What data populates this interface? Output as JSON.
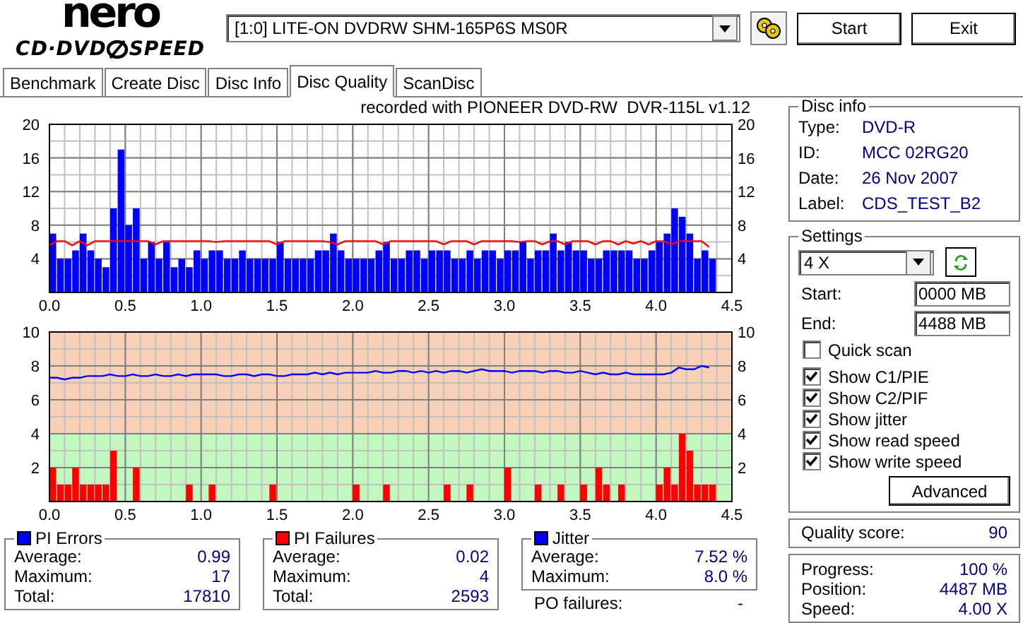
{
  "logo": {
    "brand": "nero",
    "product_left": "CD·DVD",
    "product_right": "SPEED"
  },
  "drive": {
    "value": "[1:0]  LITE-ON DVDRW SHM-165P6S MS0R"
  },
  "buttons": [
    "Start",
    "Exit"
  ],
  "tabs": [
    {
      "label": "Benchmark",
      "selected": false
    },
    {
      "label": "Create Disc",
      "selected": false
    },
    {
      "label": "Disc Info",
      "selected": false
    },
    {
      "label": "Disc Quality",
      "selected": true
    },
    {
      "label": "ScanDisc",
      "selected": false
    }
  ],
  "panels": [
    {
      "title": "recorded with PIONEER DVD-RW  DVR-115L v1.12",
      "charts": [
        {
          "chart_data": {
            "type": "bar",
            "grid": true,
            "xlim": [
              0,
              4.5
            ],
            "ylim": [
              0,
              20
            ],
            "xticks": [
              {
                "value": 0,
                "label": "0.0"
              },
              {
                "value": 0.5,
                "label": "0.5"
              },
              {
                "value": 1,
                "label": "1.0"
              },
              {
                "value": 1.5,
                "label": "1.5"
              },
              {
                "value": 2,
                "label": "2.0"
              },
              {
                "value": 2.5,
                "label": "2.5"
              },
              {
                "value": 3,
                "label": "3.0"
              },
              {
                "value": 3.5,
                "label": "3.5"
              },
              {
                "value": 4,
                "label": "4.0"
              },
              {
                "value": 4.5,
                "label": "4.5"
              }
            ],
            "yticks": [
              {
                "value": 4,
                "label": "4"
              },
              {
                "value": 8,
                "label": "8"
              },
              {
                "value": 12,
                "label": "12"
              },
              {
                "value": 16,
                "label": "16"
              },
              {
                "value": 20,
                "label": "20"
              }
            ],
            "x": [
              0,
              0.05,
              0.1,
              0.15,
              0.2,
              0.25,
              0.3,
              0.35,
              0.4,
              0.45,
              0.5,
              0.55,
              0.6,
              0.65,
              0.7,
              0.75,
              0.8,
              0.85,
              0.9,
              0.95,
              1,
              1.05,
              1.1,
              1.15,
              1.2,
              1.25,
              1.3,
              1.35,
              1.4,
              1.45,
              1.5,
              1.55,
              1.6,
              1.65,
              1.7,
              1.75,
              1.8,
              1.85,
              1.9,
              1.95,
              2,
              2.05,
              2.1,
              2.15,
              2.2,
              2.25,
              2.3,
              2.35,
              2.4,
              2.45,
              2.5,
              2.55,
              2.6,
              2.65,
              2.7,
              2.75,
              2.8,
              2.85,
              2.9,
              2.95,
              3,
              3.05,
              3.1,
              3.15,
              3.2,
              3.25,
              3.3,
              3.35,
              3.4,
              3.45,
              3.5,
              3.55,
              3.6,
              3.65,
              3.7,
              3.75,
              3.8,
              3.85,
              3.9,
              3.95,
              4,
              4.05,
              4.1,
              4.15,
              4.2,
              4.25,
              4.3,
              4.35
            ],
            "series": [
              {
                "color": "#0000ff",
                "values": [
                  7,
                  4,
                  4,
                  5,
                  7,
                  5,
                  4,
                  3,
                  10,
                  17,
                  8,
                  10,
                  4,
                  6,
                  4,
                  6,
                  3,
                  4,
                  3,
                  5,
                  4,
                  5,
                  5,
                  4,
                  4,
                  5,
                  4,
                  4,
                  4,
                  4,
                  6,
                  4,
                  4,
                  4,
                  4,
                  5,
                  5,
                  7,
                  5,
                  4,
                  4,
                  4,
                  4,
                  5,
                  6,
                  4,
                  4,
                  5,
                  5,
                  4,
                  5,
                  5,
                  5,
                  4,
                  4,
                  5,
                  4,
                  5,
                  5,
                  4,
                  5,
                  5,
                  6,
                  4,
                  5,
                  5,
                  7,
                  5,
                  6,
                  5,
                  5,
                  4,
                  4,
                  5,
                  5,
                  5,
                  5,
                  4,
                  4,
                  5,
                  6,
                  7,
                  10,
                  9,
                  7,
                  4,
                  5,
                  4
                ]
              }
            ]
          }
        },
        {
          "chart_data": {
            "type": "line",
            "xlim": [
              0,
              4.5
            ],
            "ylim": [
              0,
              20
            ],
            "yticks": [
              {
                "value": 4,
                "label": "4"
              },
              {
                "value": 8,
                "label": "8"
              },
              {
                "value": 12,
                "label": "12"
              },
              {
                "value": 16,
                "label": "16"
              },
              {
                "value": 20,
                "label": "20"
              }
            ],
            "x": [
              0,
              0.05,
              0.1,
              0.15,
              0.2,
              0.25,
              0.3,
              0.35,
              0.4,
              0.45,
              0.5,
              0.55,
              0.6,
              0.65,
              0.7,
              0.75,
              0.8,
              0.85,
              0.9,
              0.95,
              1,
              1.05,
              1.1,
              1.15,
              1.2,
              1.25,
              1.3,
              1.35,
              1.4,
              1.45,
              1.5,
              1.55,
              1.6,
              1.65,
              1.7,
              1.75,
              1.8,
              1.85,
              1.9,
              1.95,
              2,
              2.05,
              2.1,
              2.15,
              2.2,
              2.25,
              2.3,
              2.35,
              2.4,
              2.45,
              2.5,
              2.55,
              2.6,
              2.65,
              2.7,
              2.75,
              2.8,
              2.85,
              2.9,
              2.95,
              3,
              3.05,
              3.1,
              3.15,
              3.2,
              3.25,
              3.3,
              3.35,
              3.4,
              3.45,
              3.5,
              3.55,
              3.6,
              3.65,
              3.7,
              3.75,
              3.8,
              3.85,
              3.9,
              3.95,
              4,
              4.05,
              4.1,
              4.15,
              4.2,
              4.25,
              4.3,
              4.35
            ],
            "series": [
              {
                "color": "#ff0000",
                "values": [
                  5.6,
                  6.1,
                  6.1,
                  5.6,
                  6.1,
                  5.6,
                  6.1,
                  6.1,
                  6.1,
                  6.1,
                  6.1,
                  6.1,
                  6.1,
                  6.1,
                  5.7,
                  6.1,
                  6.1,
                  6.1,
                  6.1,
                  6.1,
                  6.1,
                  6.1,
                  6.0,
                  6.1,
                  6.1,
                  6.1,
                  6.1,
                  6.1,
                  6.1,
                  6.1,
                  5.7,
                  6.1,
                  6.1,
                  6.1,
                  6.1,
                  6.1,
                  6.1,
                  6.0,
                  5.7,
                  6.1,
                  6.1,
                  6.1,
                  6.1,
                  6.1,
                  5.7,
                  6.1,
                  6.1,
                  6.1,
                  6.1,
                  6.1,
                  6.1,
                  6.1,
                  5.7,
                  6.1,
                  6.1,
                  6.1,
                  5.7,
                  6.1,
                  6.1,
                  6.1,
                  6.1,
                  6.1,
                  6.0,
                  6.1,
                  6.1,
                  5.7,
                  6.1,
                  6.1,
                  5.7,
                  6.1,
                  6.1,
                  6.1,
                  5.7,
                  6.1,
                  6.1,
                  5.7,
                  6.1,
                  5.8,
                  6.1,
                  5.7,
                  6.1,
                  6.1,
                  5.7,
                  6.1,
                  6.1,
                  6.1,
                  6.1,
                  5.4
                ]
              }
            ]
          }
        }
      ]
    },
    {
      "charts": [
        {
          "chart_data": {
            "type": "bar",
            "grid": true,
            "xlim": [
              0,
              4.5
            ],
            "ylim": [
              0,
              10
            ],
            "xticks": [
              {
                "value": 0,
                "label": "0.0"
              },
              {
                "value": 0.5,
                "label": "0.5"
              },
              {
                "value": 1,
                "label": "1.0"
              },
              {
                "value": 1.5,
                "label": "1.5"
              },
              {
                "value": 2,
                "label": "2.0"
              },
              {
                "value": 2.5,
                "label": "2.5"
              },
              {
                "value": 3,
                "label": "3.0"
              },
              {
                "value": 3.5,
                "label": "3.5"
              },
              {
                "value": 4,
                "label": "4.0"
              },
              {
                "value": 4.5,
                "label": "4.5"
              }
            ],
            "yticks": [
              {
                "value": 2,
                "label": "2"
              },
              {
                "value": 4,
                "label": "4"
              },
              {
                "value": 6,
                "label": "6"
              },
              {
                "value": 8,
                "label": "8"
              },
              {
                "value": 10,
                "label": "10"
              }
            ],
            "x": [
              0,
              0.05,
              0.1,
              0.15,
              0.2,
              0.25,
              0.3,
              0.35,
              0.4,
              0.45,
              0.5,
              0.55,
              0.6,
              0.65,
              0.7,
              0.75,
              0.8,
              0.85,
              0.9,
              0.95,
              1,
              1.05,
              1.1,
              1.15,
              1.2,
              1.25,
              1.3,
              1.35,
              1.4,
              1.45,
              1.5,
              1.55,
              1.6,
              1.65,
              1.7,
              1.75,
              1.8,
              1.85,
              1.9,
              1.95,
              2,
              2.05,
              2.1,
              2.15,
              2.2,
              2.25,
              2.3,
              2.35,
              2.4,
              2.45,
              2.5,
              2.55,
              2.6,
              2.65,
              2.7,
              2.75,
              2.8,
              2.85,
              2.9,
              2.95,
              3,
              3.05,
              3.1,
              3.15,
              3.2,
              3.25,
              3.3,
              3.35,
              3.4,
              3.45,
              3.5,
              3.55,
              3.6,
              3.65,
              3.7,
              3.75,
              3.8,
              3.85,
              3.9,
              3.95,
              4,
              4.05,
              4.1,
              4.15,
              4.2,
              4.25,
              4.3,
              4.35
            ],
            "series": [
              {
                "color": "#ff0000",
                "values": [
                  2,
                  1,
                  1,
                  2,
                  1,
                  1,
                  1,
                  1,
                  3,
                  0,
                  0,
                  2,
                  0,
                  0,
                  0,
                  0,
                  0,
                  0,
                  1,
                  0,
                  0,
                  1,
                  0,
                  0,
                  0,
                  0,
                  0,
                  0,
                  0,
                  1,
                  0,
                  0,
                  0,
                  0,
                  0,
                  0,
                  0,
                  0,
                  0,
                  0,
                  1,
                  0,
                  0,
                  0,
                  1,
                  0,
                  0,
                  0,
                  0,
                  0,
                  0,
                  0,
                  1,
                  0,
                  0,
                  1,
                  0,
                  0,
                  0,
                  0,
                  2,
                  0,
                  0,
                  0,
                  1,
                  0,
                  0,
                  1,
                  0,
                  0,
                  1,
                  0,
                  2,
                  1,
                  0,
                  1,
                  0,
                  0,
                  0,
                  0,
                  1,
                  2,
                  1,
                  4,
                  3,
                  1,
                  1,
                  1
                ]
              }
            ]
          }
        },
        {
          "chart_data": {
            "type": "line",
            "xlim": [
              0,
              4.5
            ],
            "ylim": [
              0,
              10
            ],
            "yticks": [
              {
                "value": 2,
                "label": "2"
              },
              {
                "value": 4,
                "label": "4"
              },
              {
                "value": 6,
                "label": "6"
              },
              {
                "value": 8,
                "label": "8"
              },
              {
                "value": 10,
                "label": "10"
              }
            ],
            "x": [
              0,
              0.05,
              0.1,
              0.15,
              0.2,
              0.25,
              0.3,
              0.35,
              0.4,
              0.45,
              0.5,
              0.55,
              0.6,
              0.65,
              0.7,
              0.75,
              0.8,
              0.85,
              0.9,
              0.95,
              1,
              1.05,
              1.1,
              1.15,
              1.2,
              1.25,
              1.3,
              1.35,
              1.4,
              1.45,
              1.5,
              1.55,
              1.6,
              1.65,
              1.7,
              1.75,
              1.8,
              1.85,
              1.9,
              1.95,
              2,
              2.05,
              2.1,
              2.15,
              2.2,
              2.25,
              2.3,
              2.35,
              2.4,
              2.45,
              2.5,
              2.55,
              2.6,
              2.65,
              2.7,
              2.75,
              2.8,
              2.85,
              2.9,
              2.95,
              3,
              3.05,
              3.1,
              3.15,
              3.2,
              3.25,
              3.3,
              3.35,
              3.4,
              3.45,
              3.5,
              3.55,
              3.6,
              3.65,
              3.7,
              3.75,
              3.8,
              3.85,
              3.9,
              3.95,
              4,
              4.05,
              4.1,
              4.15,
              4.2,
              4.25,
              4.3,
              4.35
            ],
            "series": [
              {
                "color": "#0000ff",
                "values": [
                  7.3,
                  7.3,
                  7.2,
                  7.3,
                  7.3,
                  7.4,
                  7.4,
                  7.4,
                  7.5,
                  7.4,
                  7.4,
                  7.5,
                  7.4,
                  7.4,
                  7.5,
                  7.4,
                  7.4,
                  7.5,
                  7.4,
                  7.5,
                  7.5,
                  7.5,
                  7.5,
                  7.4,
                  7.4,
                  7.5,
                  7.5,
                  7.4,
                  7.5,
                  7.5,
                  7.4,
                  7.4,
                  7.5,
                  7.5,
                  7.5,
                  7.6,
                  7.5,
                  7.6,
                  7.5,
                  7.6,
                  7.6,
                  7.6,
                  7.6,
                  7.7,
                  7.6,
                  7.6,
                  7.7,
                  7.7,
                  7.6,
                  7.7,
                  7.6,
                  7.7,
                  7.6,
                  7.7,
                  7.7,
                  7.6,
                  7.7,
                  7.8,
                  7.7,
                  7.7,
                  7.7,
                  7.6,
                  7.7,
                  7.7,
                  7.7,
                  7.6,
                  7.7,
                  7.7,
                  7.6,
                  7.6,
                  7.7,
                  7.6,
                  7.5,
                  7.6,
                  7.5,
                  7.5,
                  7.6,
                  7.5,
                  7.5,
                  7.5,
                  7.5,
                  7.5,
                  7.6,
                  7.9,
                  7.8,
                  7.8,
                  8.0,
                  7.9
                ]
              }
            ]
          }
        }
      ]
    }
  ],
  "stats": [
    {
      "title": "PI Errors",
      "color": "#0000ff",
      "rows": [
        {
          "label": "Average:",
          "value": "0.99"
        },
        {
          "label": "Maximum:",
          "value": "17"
        },
        {
          "label": "Total:",
          "value": "17810"
        }
      ]
    },
    {
      "title": "PI Failures",
      "color": "#ff0000",
      "rows": [
        {
          "label": "Average:",
          "value": "0.02"
        },
        {
          "label": "Maximum:",
          "value": "4"
        },
        {
          "label": "Total:",
          "value": "2593"
        }
      ]
    },
    {
      "title": "Jitter",
      "color": "#0000ff",
      "rows": [
        {
          "label": "Average:",
          "value": "7.52 %"
        },
        {
          "label": "Maximum:",
          "value": "8.0 %"
        }
      ]
    }
  ],
  "po_failures": {
    "label": "PO failures:",
    "value": "-"
  },
  "disc_info": {
    "title": "Disc info",
    "rows": [
      {
        "label": "Type:",
        "value": "DVD-R"
      },
      {
        "label": "ID:",
        "value": "MCC 02RG20"
      },
      {
        "label": "Date:",
        "value": "26 Nov 2007"
      },
      {
        "label": "Label:",
        "value": "CDS_TEST_B2"
      }
    ]
  },
  "settings": {
    "title": "Settings",
    "speed": "4 X",
    "start_label": "Start:",
    "start": "0000 MB",
    "end_label": "End:",
    "end": "4488 MB",
    "options": [
      {
        "label": "Quick scan",
        "checked": false
      },
      {
        "label": "Show C1/PIE",
        "checked": true
      },
      {
        "label": "Show C2/PIF",
        "checked": true
      },
      {
        "label": "Show jitter",
        "checked": true
      },
      {
        "label": "Show read speed",
        "checked": true
      },
      {
        "label": "Show write speed",
        "checked": true
      }
    ],
    "advanced": "Advanced"
  },
  "quality": {
    "label": "Quality score:",
    "value": "90"
  },
  "progress": [
    {
      "label": "Progress:",
      "value": "100 %"
    },
    {
      "label": "Position:",
      "value": "4487 MB"
    },
    {
      "label": "Speed:",
      "value": "4.00 X"
    }
  ]
}
